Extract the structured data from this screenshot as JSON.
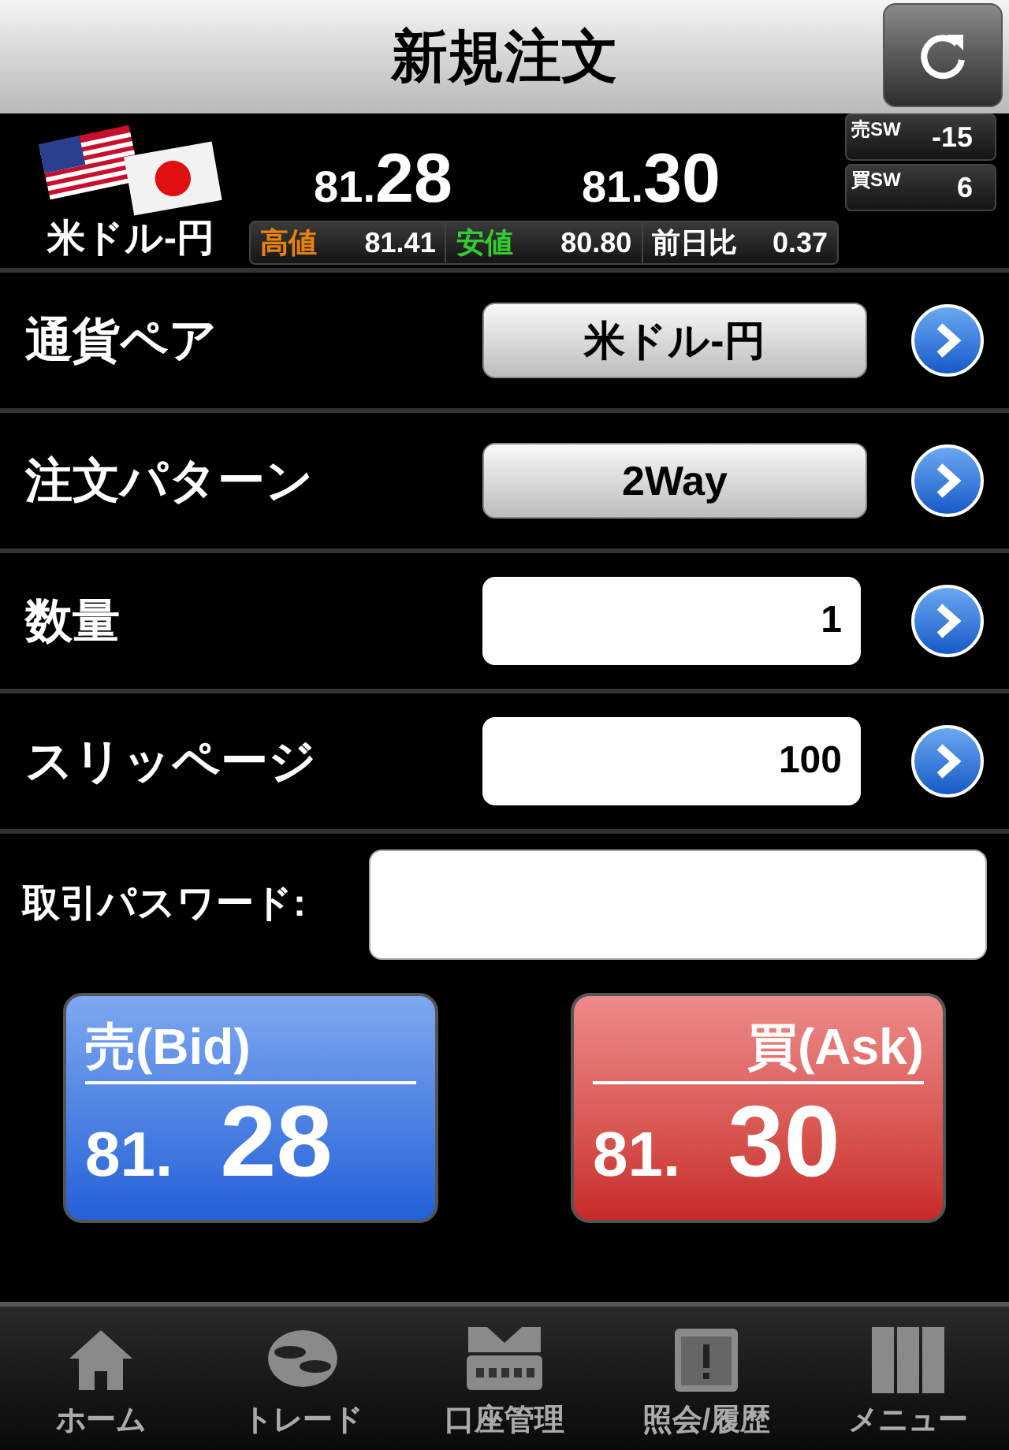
{
  "header": {
    "title": "新規注文"
  },
  "quote": {
    "pair": "米ドル-円",
    "bid": {
      "head": "81.",
      "tail": "28"
    },
    "ask": {
      "head": "81.",
      "tail": "30"
    },
    "sw": [
      {
        "label": "売SW",
        "value": "-15"
      },
      {
        "label": "買SW",
        "value": "6"
      }
    ],
    "stats": [
      {
        "kind": "high",
        "label": "高値",
        "value": "81.41"
      },
      {
        "kind": "low",
        "label": "安値",
        "value": "80.80"
      },
      {
        "kind": "change",
        "label": "前日比",
        "value": "0.37"
      }
    ]
  },
  "form": [
    {
      "kind": "select",
      "label": "通貨ペア",
      "value": "米ドル-円"
    },
    {
      "kind": "select",
      "label": "注文パターン",
      "value": "2Way"
    },
    {
      "kind": "input",
      "label": "数量",
      "value": "1"
    },
    {
      "kind": "input",
      "label": "スリッページ",
      "value": "100"
    }
  ],
  "password": {
    "label": "取引パスワード:"
  },
  "orders": [
    {
      "kind": "sell",
      "label": "売(Bid)",
      "head": "81.",
      "tail": "28"
    },
    {
      "kind": "buy",
      "label": "買(Ask)",
      "head": "81.",
      "tail": "30"
    }
  ],
  "tabbar": [
    {
      "label": "ホーム"
    },
    {
      "label": "トレード"
    },
    {
      "label": "口座管理"
    },
    {
      "label": "照会/履歴"
    },
    {
      "label": "メニュー"
    }
  ]
}
